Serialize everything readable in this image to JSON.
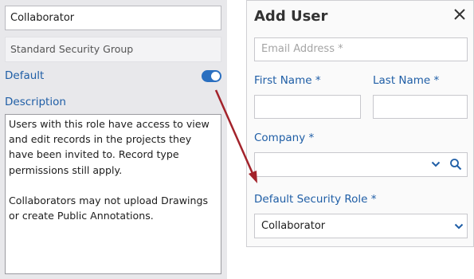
{
  "left_panel": {
    "role_name": "Collaborator",
    "security_group": "Standard Security Group",
    "default_label": "Default",
    "default_enabled": true,
    "description_label": "Description",
    "description_text": "Users with this role have access to view and edit records in the projects they have been invited to. Record type permissions still apply.\n\nCollaborators may not upload Drawings or create Public Annotations."
  },
  "add_user_dialog": {
    "title": "Add User",
    "email_placeholder": "Email Address *",
    "first_name_label": "First Name *",
    "last_name_label": "Last Name *",
    "company_label": "Company *",
    "default_role_label": "Default Security Role *",
    "default_role_value": "Collaborator"
  },
  "icons": {
    "close": "close-icon",
    "chevron": "chevron-down-icon",
    "search": "search-icon",
    "toggle": "toggle-switch"
  },
  "colors": {
    "label_blue": "#1f5ea6",
    "toggle_blue": "#2a6fc0",
    "annotation_arrow": "#a3232b",
    "panel_gray": "#e8e8eb"
  }
}
